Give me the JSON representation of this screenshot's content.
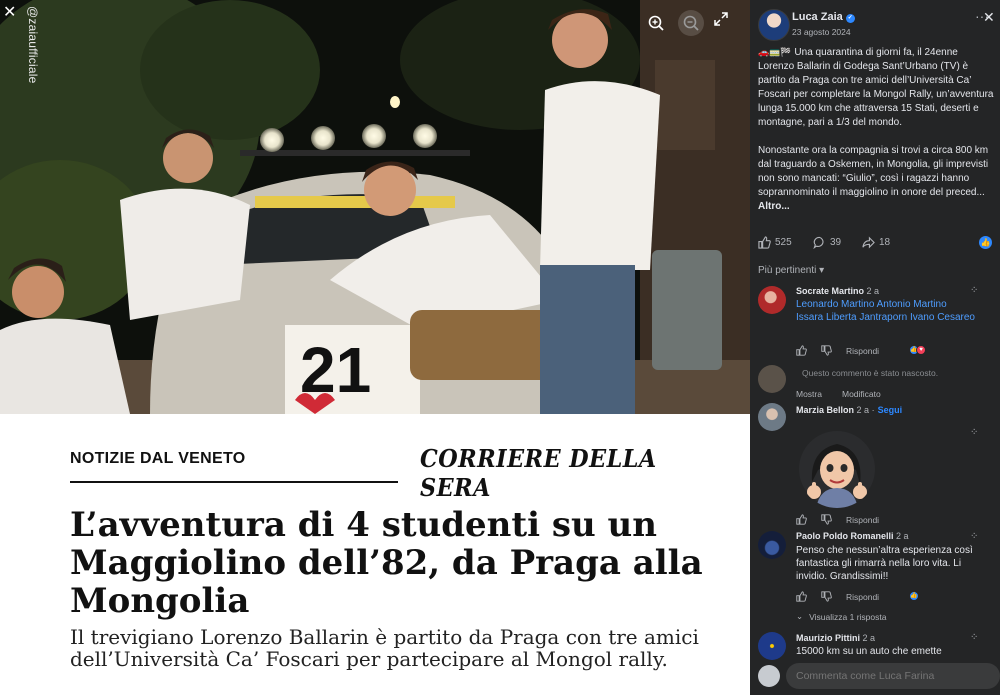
{
  "viewer": {
    "watermark": "@zaiaufficiale",
    "zoom_in_icon": "+",
    "zoom_out_icon": "−",
    "close_icon": "✕",
    "fullscreen_icon": "⤢"
  },
  "photo": {
    "car_number": "21"
  },
  "article": {
    "section": "NOTIZIE DAL VENETO",
    "masthead": "CORRIERE DELLA SERA",
    "headline": "L’avventura di 4 studenti su un Maggiolino dell’82, da Praga alla Mongolia",
    "summary": "Il trevigiano Lorenzo Ballarin è partito da Praga con tre amici dell’Università Ca’ Foscari per partecipare al Mongol rally."
  },
  "post": {
    "author": "Luca Zaia",
    "date": "23 agosto 2024",
    "emoji_prefix": "🚗🚃🏁",
    "paragraph1": "Una quarantina di giorni fa, il 24enne Lorenzo Ballarin di Godega Sant’Urbano (TV) è partito da Praga con tre amici dell’Università Ca’ Foscari per completare la Mongol Rally, un’avventura lunga 15.000 km che attraversa 15 Stati, deserti e montagne, pari a 1/3 del mondo.",
    "paragraph2": "Nonostante ora la compagnia si trovi a circa 800 km dal traguardo a Oskemen, in Mongolia, gli imprevisti non sono mancati: “Giulio”, così i ragazzi hanno soprannominato il maggiolino in onore del preced...",
    "more_link": "Altro...",
    "likes": "525",
    "comments": "39",
    "shares": "18"
  },
  "comments_sort": "Più pertinenti",
  "comments": [
    {
      "author": "Socrate Martino",
      "time": "2 a",
      "text": "Leonardo Martino Antonio Martino Issara Liberta Jantraporn Ivano Cesareo",
      "reply": "Rispondi"
    },
    {
      "hidden_notice": "Questo commento è stato nascosto.",
      "show": "Mostra",
      "edited": "Modificato"
    },
    {
      "author": "Marzia Bellon",
      "time": "2 a",
      "follow": "Segui",
      "reply": "Rispondi"
    },
    {
      "author": "Paolo Poldo Romanelli",
      "time": "2 a",
      "text": "Penso che nessun’altra esperienza così fantastica gli rimarrà nella loro vita. Li invidio. Grandissimi!!",
      "reply": "Rispondi",
      "view_replies": "Visualizza 1 risposta"
    },
    {
      "author": "Maurizio Pittini",
      "time": "2 a",
      "text": "15000 km su un auto che emette"
    }
  ],
  "reply_box": {
    "placeholder": "Commenta come Luca Farina"
  },
  "colors": {
    "panel_bg": "#242526",
    "link_blue": "#4e9dff",
    "accent_blue": "#2d88ff"
  }
}
